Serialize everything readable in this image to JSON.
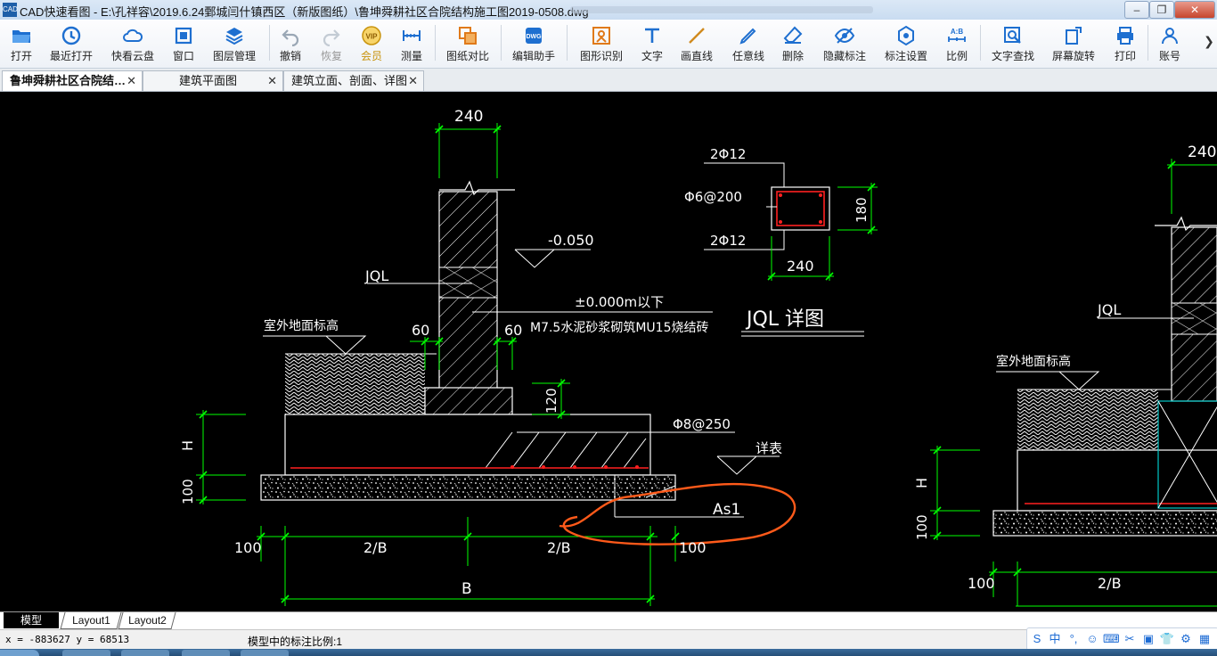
{
  "window": {
    "title": "CAD快速看图 - E:\\孔祥容\\2019.6.24鄄城闫什镇西区（新版图纸）\\鲁坤舜耕社区合院结构施工图2019-0508.dwg",
    "app_icon": "CAD"
  },
  "toolbar": {
    "items": [
      {
        "label": "打开",
        "icon": "folder-open-icon",
        "color": "#1e6fd0",
        "enabled": true
      },
      {
        "label": "最近打开",
        "icon": "recent-clock-icon",
        "color": "#1e6fd0",
        "enabled": true
      },
      {
        "label": "快看云盘",
        "icon": "cloud-icon",
        "color": "#1e6fd0",
        "enabled": true
      },
      {
        "label": "窗口",
        "icon": "window-icon",
        "color": "#1e6fd0",
        "enabled": true
      },
      {
        "label": "图层管理",
        "icon": "layers-icon",
        "color": "#1e6fd0",
        "enabled": true
      },
      {
        "label": "撤销",
        "icon": "undo-icon",
        "color": "#9aa7b5",
        "enabled": true
      },
      {
        "label": "恢复",
        "icon": "redo-icon",
        "color": "#9aa7b5",
        "enabled": false
      },
      {
        "label": "会员",
        "icon": "vip-icon",
        "color": "#d4a017",
        "enabled": true
      },
      {
        "label": "测量",
        "icon": "measure-icon",
        "color": "#1e6fd0",
        "enabled": true
      },
      {
        "label": "图纸对比",
        "icon": "compare-icon",
        "color": "#e07a1a",
        "enabled": true
      },
      {
        "label": "编辑助手",
        "icon": "edit-assistant-icon",
        "color": "#1e6fd0",
        "enabled": true
      },
      {
        "label": "图形识别",
        "icon": "shape-recognize-icon",
        "color": "#e07a1a",
        "enabled": true
      },
      {
        "label": "文字",
        "icon": "text-icon",
        "color": "#1e6fd0",
        "enabled": true
      },
      {
        "label": "画直线",
        "icon": "line-icon",
        "color": "#d08a1e",
        "enabled": true
      },
      {
        "label": "任意线",
        "icon": "freehand-pen-icon",
        "color": "#1e6fd0",
        "enabled": true
      },
      {
        "label": "删除",
        "icon": "eraser-icon",
        "color": "#1e6fd0",
        "enabled": true
      },
      {
        "label": "隐藏标注",
        "icon": "eye-hide-icon",
        "color": "#1e6fd0",
        "enabled": true
      },
      {
        "label": "标注设置",
        "icon": "annotation-settings-icon",
        "color": "#1e6fd0",
        "enabled": true
      },
      {
        "label": "比例",
        "icon": "scale-icon",
        "color": "#1e6fd0",
        "enabled": true
      },
      {
        "label": "文字查找",
        "icon": "text-search-icon",
        "color": "#1e6fd0",
        "enabled": true
      },
      {
        "label": "屏幕旋转",
        "icon": "rotate-screen-icon",
        "color": "#1e6fd0",
        "enabled": true
      },
      {
        "label": "打印",
        "icon": "print-icon",
        "color": "#1e6fd0",
        "enabled": true
      },
      {
        "label": "账号",
        "icon": "account-icon",
        "color": "#1e6fd0",
        "enabled": true
      }
    ],
    "overflow_arrow": "❯"
  },
  "tabs": [
    {
      "label": "鲁坤舜耕社区合院结…",
      "active": true
    },
    {
      "label": "建筑平面图",
      "active": false
    },
    {
      "label": "建筑立面、剖面、详图",
      "active": false
    }
  ],
  "drawing": {
    "texts": {
      "dim_240_top": "240",
      "level_minus": "-0.050",
      "jql_left": "JQL",
      "pm_zero": "±0.000m以下",
      "material_note": "M7.5水泥砂浆砌筑MU15烧结砖",
      "outdoor_level": "室外地面标高",
      "dim_60_left": "60",
      "dim_60_right": "60",
      "dim_120": "120",
      "rebar_phi8": "Φ8@250",
      "see_table": "详表",
      "dim_H": "H",
      "dim_100_v": "100",
      "as1": "As1",
      "dim_100_l": "100",
      "dim_2B_l": "2/B",
      "dim_2B_r": "2/B",
      "dim_100_r": "100",
      "dim_B": "B",
      "d_top_2phi12": "2Φ12",
      "d_stirrup": "Φ6@200",
      "d_bot_2phi12": "2Φ12",
      "d_180": "180",
      "d_240": "240",
      "jql_detail_title": "JQL 详图",
      "r_240": "240",
      "r_jql": "JQL",
      "r_outdoor": "室外地面标高",
      "r_H": "H",
      "r_100_v": "100",
      "r_100": "100",
      "r_2B": "2/B"
    },
    "colors": {
      "dimension": "#00ff00",
      "line": "#ffffff",
      "rebar": "#ff2020",
      "annotation": "#ff5a1a",
      "section_cyan": "#00c8c8"
    }
  },
  "layout_tabs": [
    {
      "label": "模型",
      "active": true
    },
    {
      "label": "Layout1",
      "active": false
    },
    {
      "label": "Layout2",
      "active": false
    }
  ],
  "status": {
    "coordinates": "x = -883627  y = 68513",
    "scale_text": "模型中的标注比例:1"
  },
  "ime": {
    "items": [
      "S",
      "中",
      "°,",
      "☺",
      "⌨",
      "✂",
      "▣",
      "👕",
      "⚙",
      "▦"
    ]
  }
}
